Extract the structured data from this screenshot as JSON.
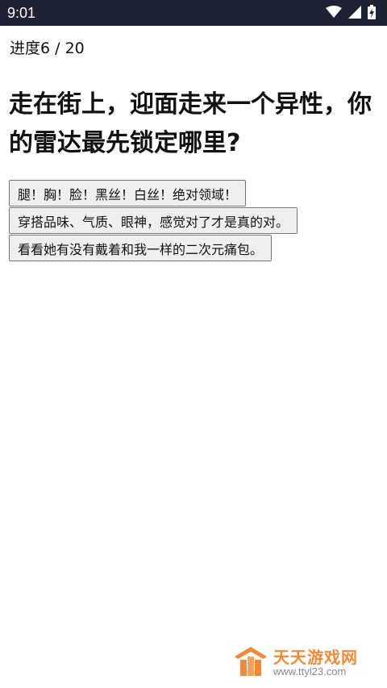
{
  "status_bar": {
    "time": "9:01",
    "icons": [
      "wifi-icon",
      "cellular-signal-icon",
      "battery-charging-icon"
    ],
    "background": "#1f2235"
  },
  "quiz": {
    "progress_text": "进度6 / 20",
    "question": "走在街上，迎面走来一个异性，你的雷达最先锁定哪里?",
    "options": [
      "腿！胸！脸！黑丝！白丝！绝对领域！",
      "穿搭品味、气质、眼神，感觉对了才是真的对。",
      "看看她有没有戴着和我一样的二次元痛包。"
    ]
  },
  "watermark": {
    "name": "天天游戏网",
    "url": "www.ttyl23.com",
    "color": "#f08a3a"
  }
}
